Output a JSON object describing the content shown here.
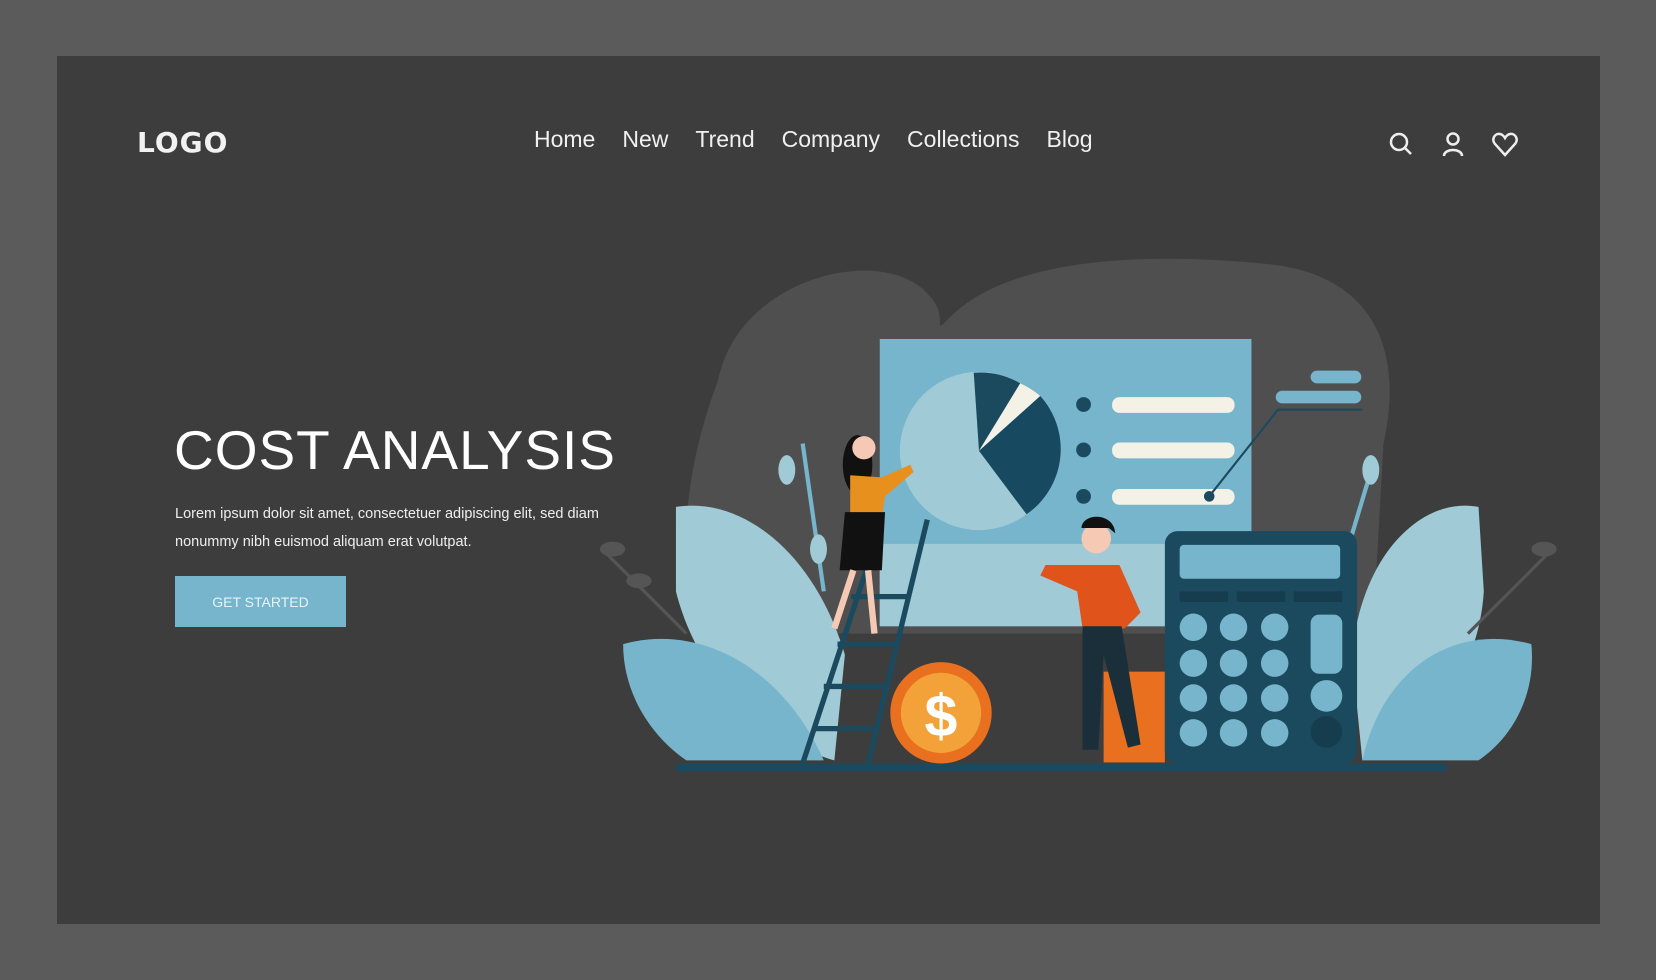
{
  "header": {
    "logo": "LOGO",
    "nav": [
      "Home",
      "New",
      "Trend",
      "Company",
      "Collections",
      "Blog"
    ],
    "icons": [
      "search-icon",
      "user-icon",
      "heart-icon"
    ]
  },
  "hero": {
    "title": "COST ANALYSIS",
    "description": "Lorem ipsum dolor sit amet, consectetuer adipiscing elit, sed diam nonummy nibh euismod aliquam erat volutpat.",
    "cta": "GET STARTED"
  },
  "colors": {
    "page": "#5b5b5b",
    "panel": "#3d3d3d",
    "accent": "#76b5cc",
    "dark_teal": "#1b4a5e",
    "orange": "#e8701e"
  }
}
